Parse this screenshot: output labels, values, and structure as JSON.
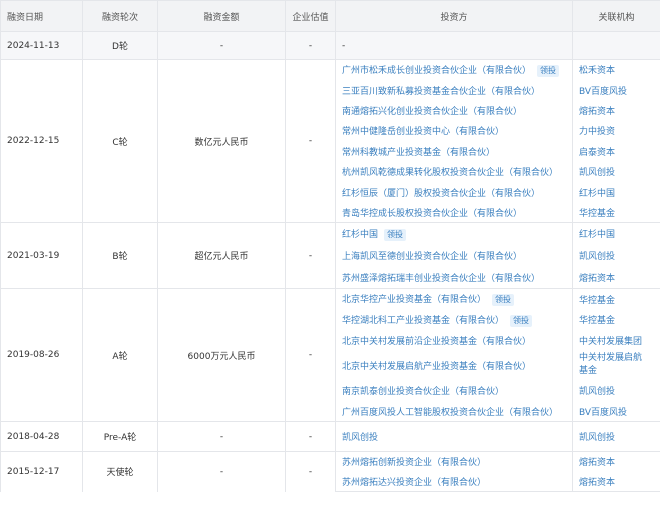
{
  "header": {
    "date": "融资日期",
    "round": "融资轮次",
    "amount": "融资金额",
    "valuation": "企业估值",
    "investors": "投资方",
    "orgs": "关联机构"
  },
  "lead_badge": "领投",
  "rows": [
    {
      "date": "2024-11-13",
      "round": "D轮",
      "amount": "-",
      "valuation": "-",
      "investors": [
        {
          "name": "-",
          "lead": false,
          "org": ""
        }
      ]
    },
    {
      "date": "2022-12-15",
      "round": "C轮",
      "amount": "数亿元人民币",
      "valuation": "-",
      "investors": [
        {
          "name": "广州市松禾成长创业投资合伙企业（有限合伙）",
          "lead": true,
          "org": "松禾资本"
        },
        {
          "name": "三亚百川致新私募投资基金合伙企业（有限合伙）",
          "lead": false,
          "org": "BV百度风投"
        },
        {
          "name": "南通熔拓兴化创业投资合伙企业（有限合伙）",
          "lead": false,
          "org": "熔拓资本"
        },
        {
          "name": "常州中健隆岳创业投资中心（有限合伙）",
          "lead": false,
          "org": "力中投资"
        },
        {
          "name": "常州科教城产业投资基金（有限合伙）",
          "lead": false,
          "org": "启泰资本"
        },
        {
          "name": "杭州凯风乾德成果转化股权投资合伙企业（有限合伙）",
          "lead": false,
          "org": "凯风创投"
        },
        {
          "name": "红杉恒辰（厦门）股权投资合伙企业（有限合伙）",
          "lead": false,
          "org": "红杉中国"
        },
        {
          "name": "青岛华控成长股权投资合伙企业（有限合伙）",
          "lead": false,
          "org": "华控基金"
        }
      ]
    },
    {
      "date": "2021-03-19",
      "round": "B轮",
      "amount": "超亿元人民币",
      "valuation": "-",
      "investors": [
        {
          "name": "红杉中国",
          "lead": true,
          "org": "红杉中国"
        },
        {
          "name": "上海凯风至德创业投资合伙企业（有限合伙）",
          "lead": false,
          "org": "凯风创投"
        },
        {
          "name": "苏州盛泽熔拓瑞丰创业投资合伙企业（有限合伙）",
          "lead": false,
          "org": "熔拓资本"
        }
      ]
    },
    {
      "date": "2019-08-26",
      "round": "A轮",
      "amount": "6000万元人民币",
      "valuation": "-",
      "investors": [
        {
          "name": "北京华控产业投资基金（有限合伙）",
          "lead": true,
          "org": "华控基金"
        },
        {
          "name": "华控湖北科工产业投资基金（有限合伙）",
          "lead": true,
          "org": "华控基金"
        },
        {
          "name": "北京中关村发展前沿企业投资基金（有限合伙）",
          "lead": false,
          "org": "中关村发展集团"
        },
        {
          "name": "北京中关村发展启航产业投资基金（有限合伙）",
          "lead": false,
          "org": "中关村发展启航基金"
        },
        {
          "name": "南京凯泰创业投资合伙企业（有限合伙）",
          "lead": false,
          "org": "凯风创投"
        },
        {
          "name": "广州百度风投人工智能股权投资合伙企业（有限合伙）",
          "lead": false,
          "org": "BV百度风投"
        }
      ]
    },
    {
      "date": "2018-04-28",
      "round": "Pre-A轮",
      "amount": "-",
      "valuation": "-",
      "investors": [
        {
          "name": "凯风创投",
          "lead": false,
          "org": "凯风创投"
        }
      ]
    },
    {
      "date": "2015-12-17",
      "round": "天使轮",
      "amount": "-",
      "valuation": "-",
      "investors": [
        {
          "name": "苏州熔拓创新投资企业（有限合伙）",
          "lead": false,
          "org": "熔拓资本"
        },
        {
          "name": "苏州熔拓达兴投资企业（有限合伙）",
          "lead": false,
          "org": "熔拓资本"
        }
      ]
    }
  ]
}
